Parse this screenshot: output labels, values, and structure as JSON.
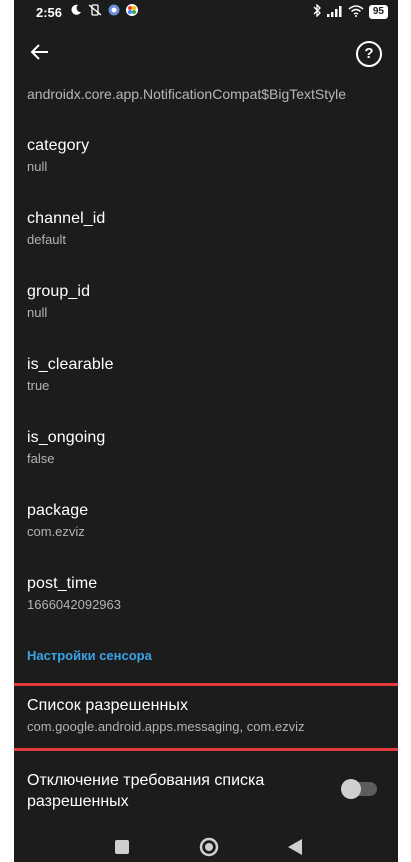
{
  "status_bar": {
    "time": "2:56",
    "battery": "95"
  },
  "app_bar": {
    "help_label": "?"
  },
  "truncated_top": {
    "value": "androidx.core.app.NotificationCompat$BigTextStyle"
  },
  "fields": [
    {
      "title": "category",
      "value": "null"
    },
    {
      "title": "channel_id",
      "value": "default"
    },
    {
      "title": "group_id",
      "value": "null"
    },
    {
      "title": "is_clearable",
      "value": "true"
    },
    {
      "title": "is_ongoing",
      "value": "false"
    },
    {
      "title": "package",
      "value": "com.ezviz"
    },
    {
      "title": "post_time",
      "value": "1666042092963"
    }
  ],
  "sensor_settings": {
    "header": "Настройки сенсора",
    "whitelist_title": "Список разрешенных",
    "whitelist_value": "com.google.android.apps.messaging, com.ezviz",
    "disable_whitelist_title": "Отключение требования списка разрешенных",
    "disable_whitelist_enabled": false
  },
  "colors": {
    "background": "#1c1c1c",
    "accent": "#3aa3e6",
    "highlight_border": "#e23b3b"
  }
}
